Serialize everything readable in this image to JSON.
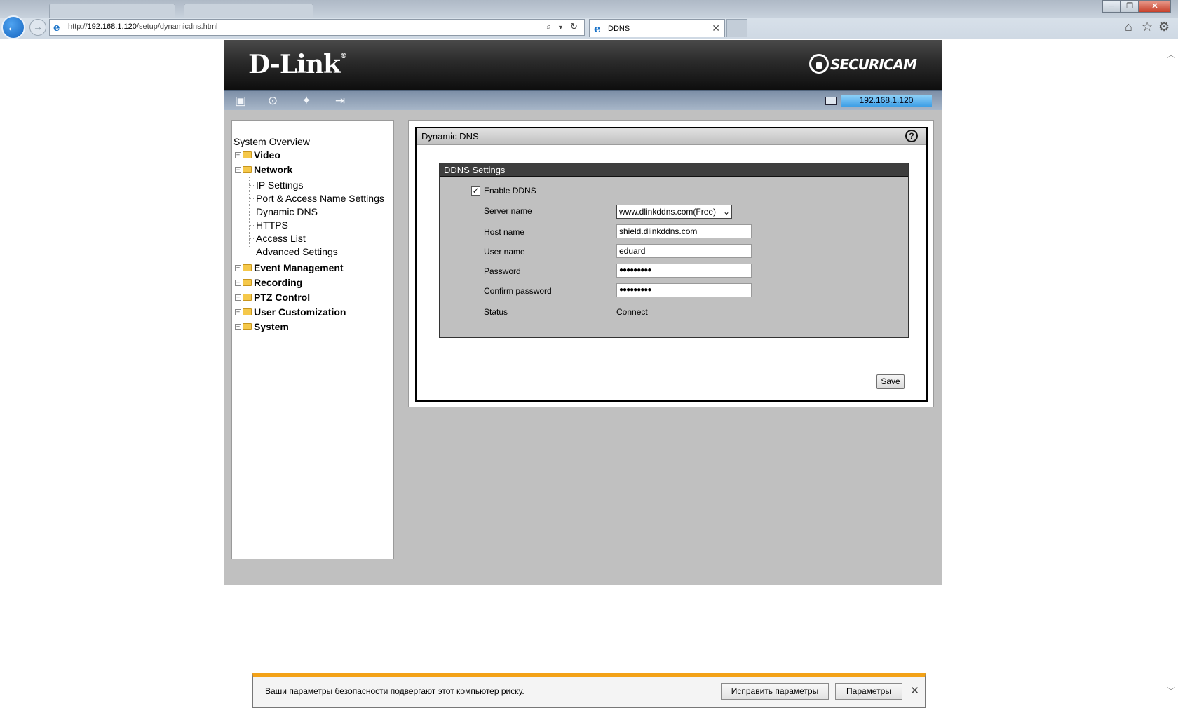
{
  "browser": {
    "url_prefix": "http://",
    "url_host": "192.168.1.120",
    "url_path": "/setup/dynamicdns.html",
    "tab_title": "DDNS",
    "window_minimize": "─",
    "window_maximize": "❐",
    "window_close": "✕",
    "back_glyph": "←",
    "forward_glyph": "→",
    "tab_close": "✕"
  },
  "camera": {
    "brand": "D-Link",
    "brand_mark": "®",
    "product": "SECURICAM",
    "ip_address": "192.168.1.120"
  },
  "sidebar": {
    "root": "System Overview",
    "folders": [
      {
        "label": "Video",
        "expanded": false
      },
      {
        "label": "Network",
        "expanded": true
      },
      {
        "label": "Event Management",
        "expanded": false
      },
      {
        "label": "Recording",
        "expanded": false
      },
      {
        "label": "PTZ Control",
        "expanded": false
      },
      {
        "label": "User Customization",
        "expanded": false
      },
      {
        "label": "System",
        "expanded": false
      }
    ],
    "network_children": [
      "IP Settings",
      "Port & Access Name Settings",
      "Dynamic DNS",
      "HTTPS",
      "Access List",
      "Advanced Settings"
    ]
  },
  "panel": {
    "title": "Dynamic DNS",
    "help_glyph": "?",
    "settings_title": "DDNS Settings",
    "enable_label": "Enable DDNS",
    "enable_checked": true,
    "fields": {
      "server_name_label": "Server name",
      "server_name_value": "www.dlinkddns.com(Free)",
      "host_name_label": "Host name",
      "host_name_value": "shield.dlinkddns.com",
      "user_name_label": "User name",
      "user_name_value": "eduard",
      "password_label": "Password",
      "password_value": "●●●●●●●●●",
      "confirm_password_label": "Confirm password",
      "confirm_password_value": "●●●●●●●●●",
      "status_label": "Status",
      "status_value": "Connect"
    },
    "save_label": "Save"
  },
  "notification": {
    "text": "Ваши параметры безопасности подвергают этот компьютер риску.",
    "fix_label": "Исправить параметры",
    "settings_label": "Параметры",
    "close_glyph": "✕"
  },
  "colors": {
    "accent_warning": "#f3a218",
    "ip_highlight": "#3d9ee6",
    "frame_gray": "#c0c0c0"
  }
}
